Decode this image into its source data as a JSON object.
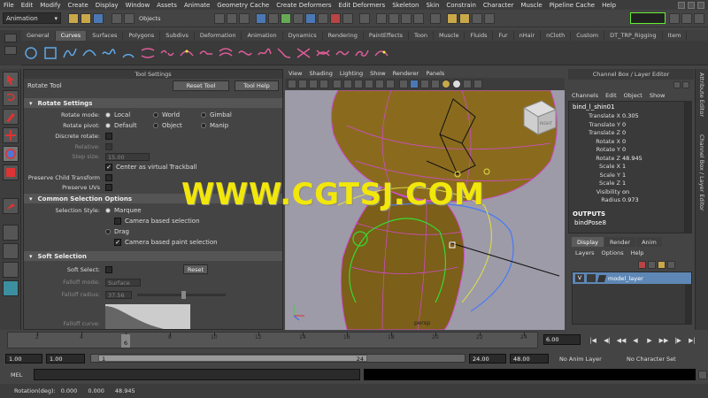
{
  "menu": [
    "File",
    "Edit",
    "Modify",
    "Create",
    "Display",
    "Window",
    "Assets",
    "Animate",
    "Geometry Cache",
    "Create Deformers",
    "Edit Deformers",
    "Skeleton",
    "Skin",
    "Constrain",
    "Character",
    "Muscle",
    "Pipeline Cache",
    "Help"
  ],
  "status": {
    "mode": "Animation",
    "selection_mask": "Objects"
  },
  "shelf_tabs": [
    "General",
    "Curves",
    "Surfaces",
    "Polygons",
    "Subdivs",
    "Deformation",
    "Animation",
    "Dynamics",
    "Rendering",
    "PaintEffects",
    "Toon",
    "Muscle",
    "Fluids",
    "Fur",
    "nHair",
    "nCloth",
    "Custom",
    "DT_TRP_Rigging",
    "Item"
  ],
  "shelf_active": "Curves",
  "tool_settings": {
    "title": "Tool Settings",
    "tool_name": "Rotate Tool",
    "reset_btn": "Reset Tool",
    "help_btn": "Tool Help",
    "rotate_settings": {
      "header": "Rotate Settings",
      "rotate_mode_label": "Rotate mode:",
      "rotate_mode_options": [
        "Local",
        "World",
        "Gimbal"
      ],
      "rotate_pivot_label": "Rotate pivot:",
      "rotate_pivot_options": [
        "Default",
        "Object",
        "Manip"
      ],
      "discrete_label": "Discrete rotate:",
      "relative_label": "Relative:",
      "step_label": "Step size:",
      "step_value": "15.00",
      "center_trackball": "Center as virtual Trackball",
      "preserve_child": "Preserve Child Transform",
      "preserve_uvs": "Preserve UVs"
    },
    "common_selection": {
      "header": "Common Selection Options",
      "style_label": "Selection Style:",
      "marquee": "Marquee",
      "camera_based": "Camera based selection",
      "drag": "Drag",
      "camera_paint": "Camera based paint selection"
    },
    "soft_selection": {
      "header": "Soft Selection",
      "soft_select_label": "Soft Select:",
      "reset_btn": "Reset",
      "falloff_mode_label": "Falloff mode:",
      "falloff_mode_value": "Surface",
      "falloff_radius_label": "Falloff radius:",
      "falloff_radius_value": "37.56",
      "falloff_curve_label": "Falloff curve:"
    }
  },
  "viewport": {
    "menu": [
      "View",
      "Shading",
      "Lighting",
      "Show",
      "Renderer",
      "Panels"
    ],
    "camera_label": "persp",
    "viewcube_label": "RIGHT"
  },
  "channel_box": {
    "header": "Channel Box / Layer Editor",
    "menu": [
      "Channels",
      "Edit",
      "Object",
      "Show"
    ],
    "object": "bind_l_shin01",
    "channels": [
      {
        "name": "Translate X",
        "value": "0.305"
      },
      {
        "name": "Translate Y",
        "value": "0"
      },
      {
        "name": "Translate Z",
        "value": "0"
      },
      {
        "name": "Rotate X",
        "value": "0"
      },
      {
        "name": "Rotate Y",
        "value": "0"
      },
      {
        "name": "Rotate Z",
        "value": "48.945"
      },
      {
        "name": "Scale X",
        "value": "1"
      },
      {
        "name": "Scale Y",
        "value": "1"
      },
      {
        "name": "Scale Z",
        "value": "1"
      },
      {
        "name": "Visibility",
        "value": "on"
      },
      {
        "name": "Radius",
        "value": "0.973"
      }
    ],
    "outputs_label": "OUTPUTS",
    "output_node": "bindPose8"
  },
  "sidebar_tabs": [
    "Attribute Editor",
    "Channel Box / Layer Editor"
  ],
  "layer_editor": {
    "tabs": [
      "Display",
      "Render",
      "Anim"
    ],
    "active_tab": "Display",
    "menu": [
      "Layers",
      "Options",
      "Help"
    ],
    "layer": {
      "visible": "V",
      "name": "model_layer"
    }
  },
  "time_slider": {
    "ticks": [
      "2",
      "4",
      "6",
      "8",
      "10",
      "12",
      "14",
      "16",
      "18",
      "20",
      "22",
      "24"
    ],
    "current_marker": "6",
    "current_frame": "6.00"
  },
  "range_slider": {
    "start": "1.00",
    "playback_start": "1.00",
    "thumb_start": "1",
    "thumb_end": "24",
    "playback_end": "24.00",
    "end": "48.00",
    "anim_layer": "No Anim Layer",
    "character_set": "No Character Set"
  },
  "command_line": {
    "label": "MEL"
  },
  "help_line": {
    "label": "Rotation(deg):",
    "values": [
      "0.000",
      "0.000",
      "48.945"
    ]
  },
  "watermark": "WWW.CGTSJ.COM"
}
